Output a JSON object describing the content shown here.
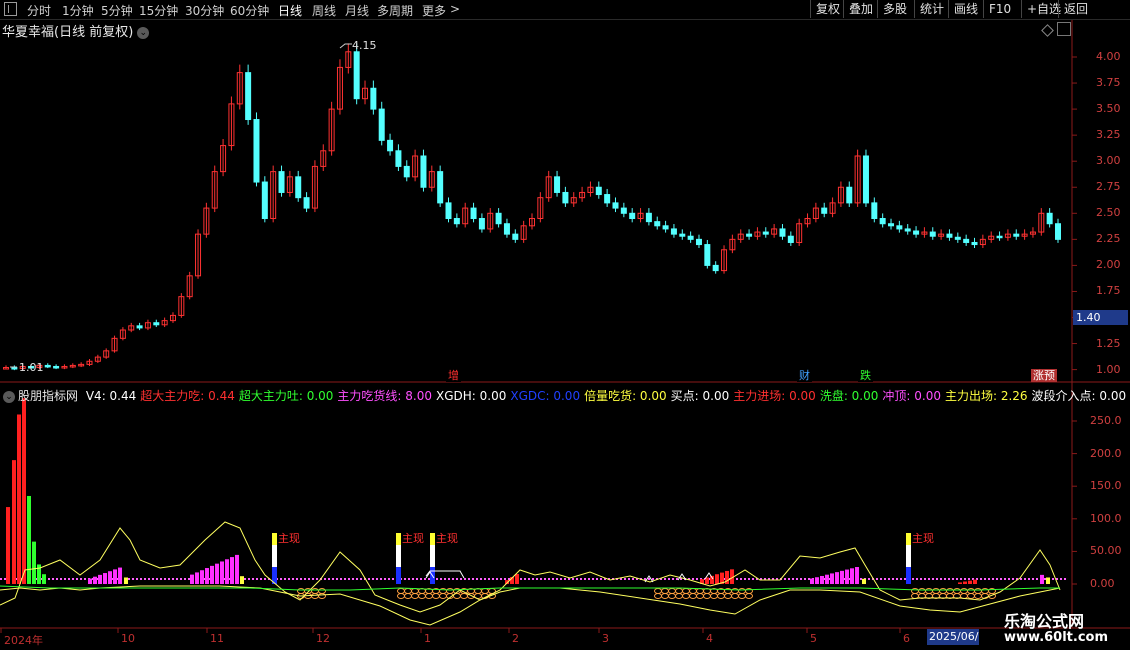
{
  "toolbar": {
    "periods": [
      "分时",
      "1分钟",
      "5分钟",
      "15分钟",
      "30分钟",
      "60分钟",
      "日线",
      "周线",
      "月线",
      "多周期",
      "更多"
    ],
    "active_period": "日线",
    "more_arrow": ">",
    "buttons": [
      "复权",
      "叠加",
      "多股",
      "统计",
      "画线",
      "F10",
      "+自选",
      "返回"
    ]
  },
  "main_chart": {
    "title": "华夏幸福(日线 前复权)",
    "high_label": "4.15",
    "low_label": "1.01",
    "current_price": "1.40",
    "y_ticks": [
      "4.00",
      "3.75",
      "3.50",
      "3.25",
      "3.00",
      "2.75",
      "2.50",
      "2.25",
      "2.00",
      "1.75",
      "1.50",
      "1.25",
      "1.00"
    ],
    "event_tags": [
      {
        "text": "增",
        "color": "#ff3030",
        "bg": "#000"
      },
      {
        "text": "财",
        "color": "#40a0ff",
        "bg": "#000"
      },
      {
        "text": "跌",
        "color": "#30ff30",
        "bg": "#000"
      },
      {
        "text": "涨预",
        "color": "#ffffff",
        "bg": "#b03030"
      }
    ]
  },
  "indicator": {
    "name": "股朋指标网",
    "fields": [
      {
        "label": "V4: 0.44",
        "color": "#ffffff"
      },
      {
        "label": "超大主力吃: 0.44",
        "color": "#ff3030"
      },
      {
        "label": "超大主力吐: 0.00",
        "color": "#30ff30"
      },
      {
        "label": "主力吃货线: 8.00",
        "color": "#ff50ff"
      },
      {
        "label": "XGDH: 0.00",
        "color": "#ffffff"
      },
      {
        "label": "XGDC: 0.00",
        "color": "#2040ff"
      },
      {
        "label": "倍量吃货: 0.00",
        "color": "#ffff40"
      },
      {
        "label": "买点: 0.00",
        "color": "#ffffff"
      },
      {
        "label": "主力进场: 0.00",
        "color": "#ff3030"
      },
      {
        "label": "洗盘: 0.00",
        "color": "#30ff30"
      },
      {
        "label": "冲顶: 0.00",
        "color": "#ff50ff"
      },
      {
        "label": "主力出场: 2.26",
        "color": "#ffff40"
      },
      {
        "label": "波段介入点: 0.00",
        "color": "#ffffff"
      }
    ],
    "y_ticks": [
      "250.0",
      "200.0",
      "150.0",
      "100.0",
      "50.00",
      "0.00"
    ],
    "signal_label": "主现"
  },
  "x_axis": {
    "labels": [
      "2024年",
      "10",
      "11",
      "12",
      "1",
      "2",
      "3",
      "4",
      "5",
      "6"
    ],
    "cursor_date": "2025/06/"
  },
  "watermark": {
    "line1": "乐淘公式网",
    "line2": "www.60lt.com"
  }
}
